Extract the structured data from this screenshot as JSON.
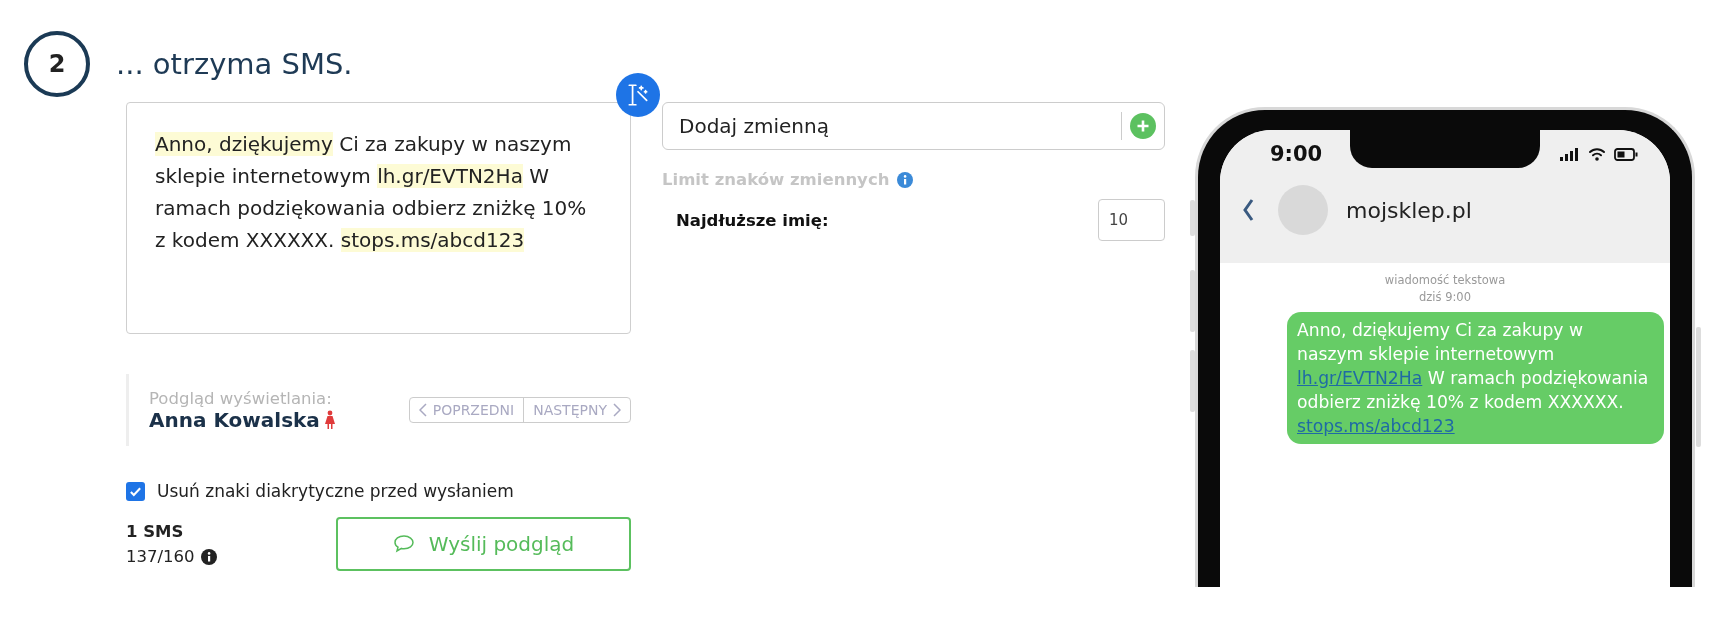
{
  "step": {
    "number": "2",
    "title": "... otrzyma SMS."
  },
  "message": {
    "segments": [
      {
        "text": "Anno, dziękujemy",
        "kind": "variable"
      },
      {
        "text": " Ci za zakupy w naszym sklepie internetowym ",
        "kind": "plain"
      },
      {
        "text": "lh.gr/EVTN2Ha",
        "kind": "variable"
      },
      {
        "text": " W ramach podziękowania odbierz zniżkę 10% z kodem XXXXXX. ",
        "kind": "plain"
      },
      {
        "text": "stops.ms/abcd123",
        "kind": "variable"
      }
    ]
  },
  "variable_picker": {
    "value": "Dodaj zmienną"
  },
  "limits": {
    "title": "Limit znaków zmiennych",
    "fields": [
      {
        "label": "Najdłuższe imię:",
        "value": "10"
      }
    ]
  },
  "preview": {
    "label": "Podgląd wyświetlania:",
    "name": "Anna Kowalska",
    "buttons": [
      {
        "label": "POPRZEDNI",
        "kind": "prev"
      },
      {
        "label": "NASTĘPNY",
        "kind": "next"
      }
    ]
  },
  "options": [
    {
      "label": "Usuń znaki diakrytyczne przed wysłaniem",
      "checked": true
    }
  ],
  "counter": {
    "parts": "1 SMS",
    "chars": "137/160"
  },
  "send_button": {
    "label": "Wyślij podgląd"
  },
  "phone": {
    "time": "9:00",
    "contact": "mojsklep.pl",
    "meta": [
      "wiadomość tekstowa",
      "dziś 9:00"
    ],
    "bubble": [
      {
        "text": "Anno, dziękujemy Ci za zakupy w naszym sklepie internetowym ",
        "kind": "plain"
      },
      {
        "text": "lh.gr/EVTN2Ha",
        "kind": "link"
      },
      {
        "text": " W ramach podziękowania odbierz zniżkę 10% z kodem XXXXXX. ",
        "kind": "plain"
      },
      {
        "text": "stops.ms/abcd123",
        "kind": "link"
      }
    ]
  }
}
